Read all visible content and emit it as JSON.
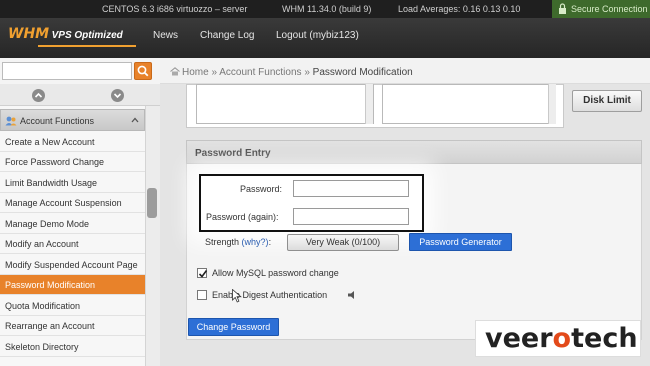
{
  "statusbar": {
    "os": "CENTOS 6.3 i686 virtuozzo – server",
    "version": "WHM 11.34.0 (build 9)",
    "load": "Load Averages: 0.16 0.13 0.10",
    "secure": "Secure Connection"
  },
  "nav": {
    "logo_whm": "WHM",
    "logo_vps": "VPS Optimized",
    "links": [
      "News",
      "Change Log",
      "Logout (mybiz123)"
    ]
  },
  "search": {
    "value": ""
  },
  "breadcrumb": {
    "home": "Home",
    "sep": "»",
    "section": "Account Functions",
    "current": "Password Modification"
  },
  "sidebar": {
    "header": "Account Functions",
    "items": [
      "Create a New Account",
      "Force Password Change",
      "Limit Bandwidth Usage",
      "Manage Account Suspension",
      "Manage Demo Mode",
      "Modify an Account",
      "Modify Suspended Account Page",
      "Password Modification",
      "Quota Modification",
      "Rearrange an Account",
      "Skeleton Directory"
    ],
    "active_index": 7
  },
  "main": {
    "disk_limit_label": "Disk Limit",
    "password_entry": {
      "header": "Password Entry",
      "password_label": "Password:",
      "password_again_label": "Password (again):",
      "password_value": "",
      "password_again_value": "",
      "strength_label": "Strength",
      "why_link": "(why?)",
      "strength_colon": ":",
      "strength_value": "Very Weak (0/100)",
      "generator_button": "Password Generator",
      "allow_mysql_label": "Allow MySQL password change",
      "allow_mysql_checked": true,
      "digest_label": "Enable Digest Authentication",
      "digest_checked": false
    },
    "change_password_button": "Change Password"
  },
  "watermark": {
    "prefix": "veer",
    "o": "o",
    "suffix": "tech"
  },
  "colors": {
    "accent": "#e8822a",
    "primary_button": "#2d6fd6",
    "secure_green": "#3e6a2c",
    "watermark_orange": "#e34a1a"
  },
  "icons": [
    "lock-icon",
    "search-icon",
    "scroll-up-icon",
    "scroll-down-icon",
    "account-functions-icon",
    "chevron-up-icon",
    "home-icon",
    "checkmark-icon",
    "digest-info-icon",
    "mouse-cursor-icon"
  ]
}
